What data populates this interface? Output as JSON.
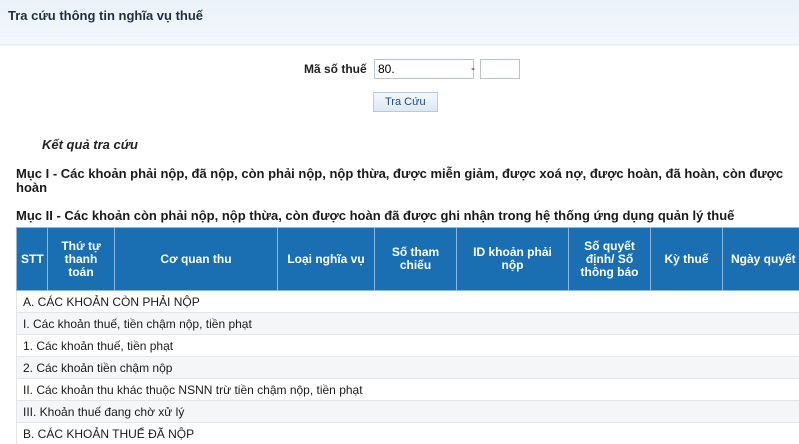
{
  "page": {
    "title": "Tra cứu thông tin nghĩa vụ thuế"
  },
  "search": {
    "label": "Mã số thuế",
    "tax_code_value": "80.",
    "separator": "-",
    "branch_value": "",
    "button_label": "Tra Cứu"
  },
  "results": {
    "heading": "Kết quả tra cứu",
    "section1": "Mục I - Các khoản phải nộp, đã nộp, còn phải nộp, nộp thừa, được miễn giảm, được xoá nợ, được hoàn, đã hoàn, còn được hoàn",
    "section2": "Mục II - Các khoản còn phải nộp, nộp thừa, còn được hoàn đã được ghi nhận trong hệ thống ứng dụng quản lý thuế"
  },
  "table": {
    "columns": [
      "STT",
      "Thứ tự thanh toán",
      "Cơ quan thu",
      "Loại nghĩa vụ",
      "Số tham chiếu",
      "ID khoản phải nộp",
      "Số quyết định/ Số thông báo",
      "Kỳ thuế",
      "Ngày quyết định/ Ngày thông báo"
    ],
    "rows": [
      "A. CÁC KHOẢN CÒN PHẢI NỘP",
      "I. Các khoản thuế, tiền chậm nộp, tiền phạt",
      "1. Các khoản thuế, tiền phạt",
      "2. Các khoản tiền chậm nộp",
      "II. Các khoản thu khác thuộc NSNN trừ tiền chậm nộp, tiền phạt",
      "III. Khoản thuế đang chờ xử lý",
      "B. CÁC KHOẢN THUẾ ĐÃ NỘP"
    ]
  },
  "colors": {
    "header_bg": "#1a6fb3",
    "title_bar_bg": "#e9f1fa",
    "link_blue": "#1a4a7e"
  }
}
